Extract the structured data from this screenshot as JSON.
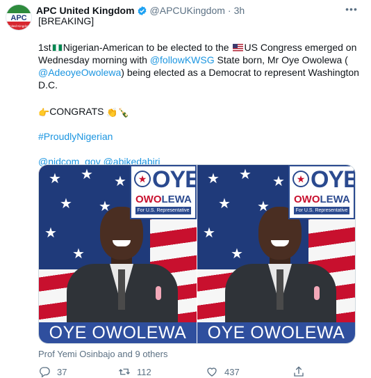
{
  "tweet": {
    "author": {
      "name": "APC United Kingdom",
      "handle": "@APCUKingdom",
      "time": "3h",
      "avatar_text": "APC",
      "avatar_subtext": "United Kingdom"
    },
    "more_label": "•••",
    "lines": {
      "breaking": "[BREAKING]",
      "l1_a": "1st",
      "l1_b": "Nigerian-American to be elected to the",
      "l1_c": "US Congress emerged on",
      "l2_a": "Wednesday morning with",
      "l2_link": "@followKWSG",
      "l2_b": "State born, Mr Oye Owolewa (",
      "l3_link": "@AdeoyeOwolewa",
      "l3_b": ") being elected as a Democrat to represent Washington",
      "l4": "D.C.",
      "congrats": "CONGRATS",
      "hashtag": "#ProudlyNigerian",
      "mention1": "@nidcom_gov",
      "mention2": "@abikedabiri"
    },
    "emojis": {
      "point": "👉",
      "clap": "👏",
      "bottle": "🍾"
    },
    "media": [
      {
        "sign_first": "OYE",
        "sign_last_a": "OWO",
        "sign_last_b": "LEWA",
        "sign_sub": "For U.S. Representative",
        "caption": "OYE OWOLEWA"
      },
      {
        "sign_first": "OYE",
        "sign_last_a": "OWO",
        "sign_last_b": "LEWA",
        "sign_sub": "For U.S. Representative",
        "caption": "OYE OWOLEWA"
      }
    ],
    "liked_by": "Prof Yemi Osinbajo and 9 others",
    "actions": {
      "replies": "37",
      "retweets": "112",
      "likes": "437"
    }
  },
  "colors": {
    "link": "#1b95e0",
    "secondary": "#5b7083",
    "verified": "#1da1f2",
    "sign_blue": "#2b4a8f",
    "flag_red": "#c8102e"
  },
  "icons": [
    "verified-icon",
    "more-icon",
    "reply-icon",
    "retweet-icon",
    "like-icon",
    "share-icon"
  ]
}
